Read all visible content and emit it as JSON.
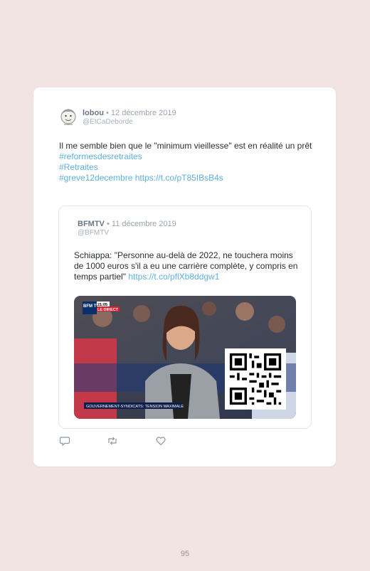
{
  "tweet": {
    "author_name": "lobou",
    "date": "• 12 décembre 2019",
    "handle": "@EtCaDeborde",
    "text": "Il me semble bien que le \"minimum vieillesse\" est en réalité un prêt",
    "hashtags": [
      "#reformesdesretraites",
      "#Retraites",
      "#greve12decembre"
    ],
    "link": "https://t.co/pT85IBsB4s"
  },
  "quoted": {
    "author_name": "BFMTV",
    "date": "• 11 décembre 2019",
    "handle": "@BFMTV",
    "text": "Schiappa: \"Personne au-delà de 2022, ne touchera moins de 1000 euros s'il a eu une carrière complète, y compris en temps partiel\"",
    "link": "https://t.co/pflXb8ddgw1",
    "media": {
      "channel_logo": "BFM TV",
      "clock": "21:05",
      "live_badge": "LE DIRECT",
      "banner": "GOUVERNEMENT-SYNDICATS: TENSION MAXIMALE"
    }
  },
  "actions": {
    "reply_icon": "reply-icon",
    "retweet_icon": "retweet-icon",
    "like_icon": "heart-icon"
  },
  "page_number": "95",
  "colors": {
    "background": "#f2e4e2",
    "link": "#5fb0de",
    "text": "#2a2f35",
    "muted": "#9aa5b1"
  }
}
